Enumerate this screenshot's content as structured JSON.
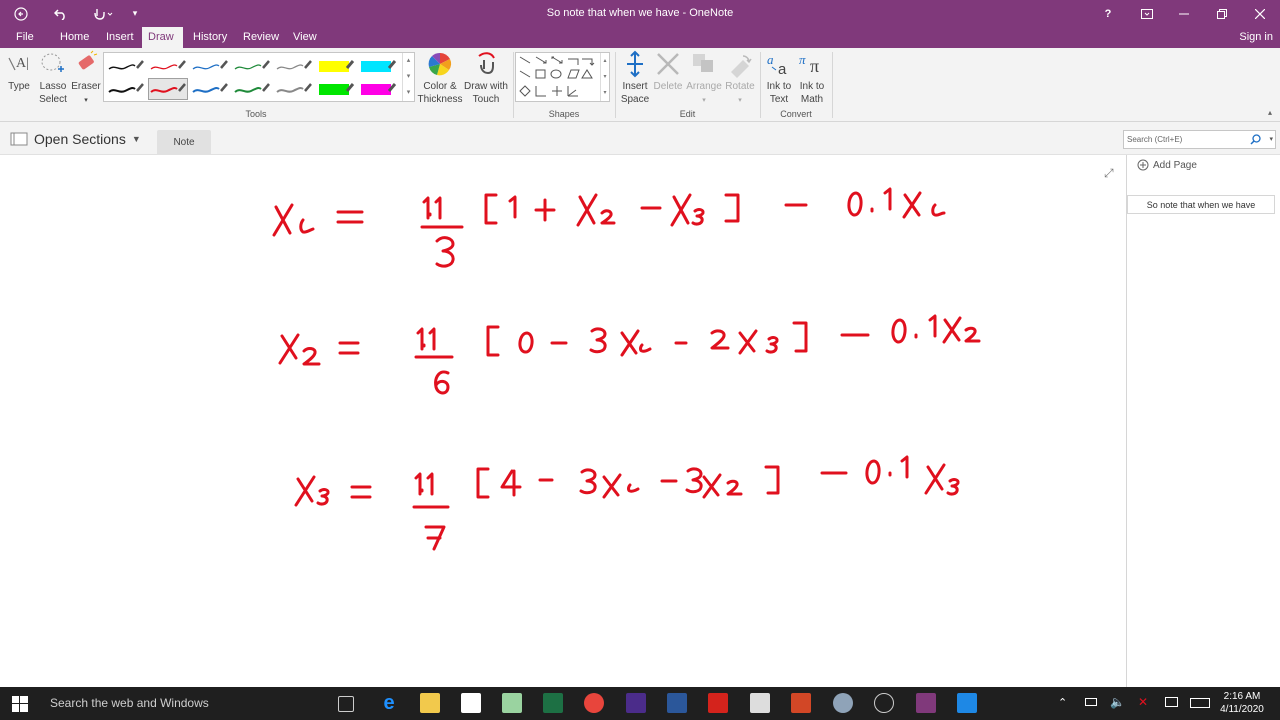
{
  "titlebar": {
    "title": "So note that when we have - OneNote",
    "help": "?"
  },
  "menu": {
    "tabs": [
      "File",
      "Home",
      "Insert",
      "Draw",
      "History",
      "Review",
      "View"
    ],
    "active": "Draw",
    "signin": "Sign in"
  },
  "ribbon": {
    "type": "Type",
    "lasso_1": "Lasso",
    "lasso_2": "Select",
    "eraser": "Eraser",
    "color_1": "Color &",
    "color_2": "Thickness",
    "draw_touch_1": "Draw with",
    "draw_touch_2": "Touch",
    "insert_space_1": "Insert",
    "insert_space_2": "Space",
    "delete": "Delete",
    "arrange": "Arrange",
    "rotate": "Rotate",
    "ink_text_1": "Ink to",
    "ink_text_2": "Text",
    "ink_math_1": "Ink to",
    "ink_math_2": "Math",
    "groups": {
      "tools": "Tools",
      "shapes": "Shapes",
      "edit": "Edit",
      "convert": "Convert"
    }
  },
  "sections": {
    "open_sections": "Open Sections",
    "note_tab": "Note",
    "search_placeholder": "Search (Ctrl+E)"
  },
  "pages": {
    "add_page": "Add Page",
    "items": [
      "So note that when we have"
    ]
  },
  "ink": {
    "color": "#e0101e",
    "equations": [
      "x_1 = (1.1/3)[1 + x_2 - x_3] - 0.1 x_1",
      "x_2 = (1.1/6)[0 - 3x_1 - 2x_3] - 0.1 x_2",
      "x_3 = (1.1/7)[4 - 3x_1 - 3x_2] - 0.1 x_3"
    ]
  },
  "taskbar": {
    "search": "Search the web and Windows",
    "time": "2:16 AM",
    "date": "4/11/2020"
  },
  "colors": {
    "onenote_purple": "#80397b",
    "ribbon_bg": "#f3f3f3",
    "taskbar_bg": "#1f1f1f"
  }
}
